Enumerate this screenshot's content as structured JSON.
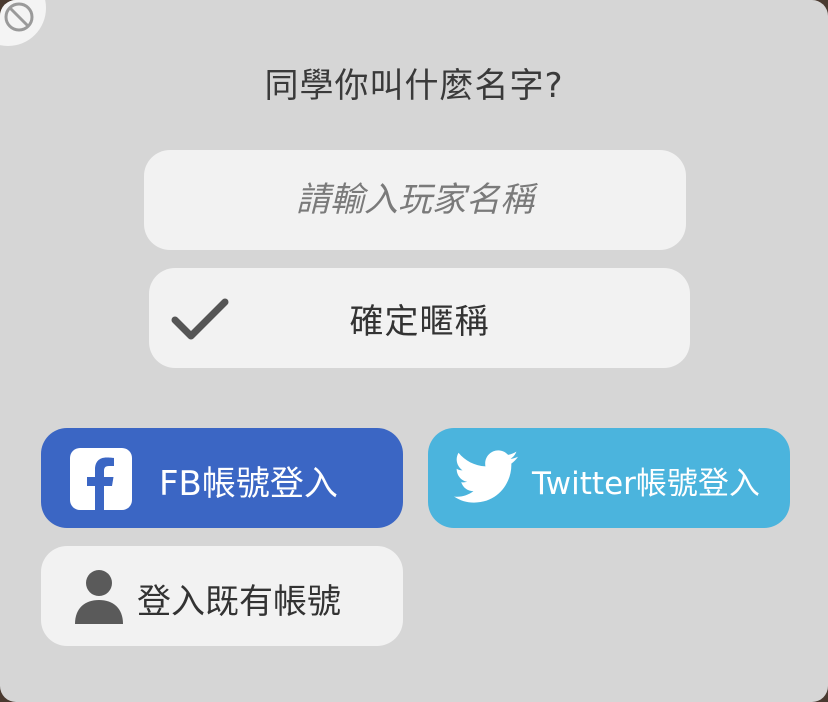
{
  "dialog": {
    "title": "同學你叫什麼名字?",
    "name_input": {
      "placeholder": "請輸入玩家名稱",
      "value": ""
    },
    "confirm_button": {
      "label": "確定暱稱",
      "icon": "checkmark-icon"
    },
    "corner_icon": "no-entry-icon"
  },
  "login": {
    "facebook": {
      "label": "FB帳號登入",
      "icon": "facebook-icon",
      "color": "#3b66c4"
    },
    "twitter": {
      "label": "Twitter帳號登入",
      "icon": "twitter-bird-icon",
      "color": "#4bb4dd"
    },
    "existing": {
      "label": "登入既有帳號",
      "icon": "person-icon"
    }
  }
}
